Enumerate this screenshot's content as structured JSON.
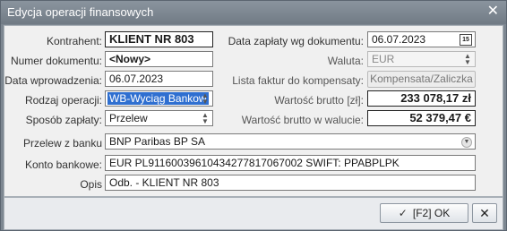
{
  "window": {
    "title": "Edycja operacji finansowych",
    "close_label": "✕"
  },
  "left": {
    "kontrahent": {
      "label": "Kontrahent:",
      "value": "KLIENT NR 803"
    },
    "numer": {
      "label": "Numer dokumentu:",
      "value": "<Nowy>"
    },
    "data_wprowadzenia": {
      "label": "Data wprowadzenia:",
      "value": "06.07.2023"
    },
    "rodzaj": {
      "label": "Rodzaj operacji:",
      "value": "WB-Wyciąg Bankow"
    },
    "sposob": {
      "label": "Sposób zapłaty:",
      "value": "Przelew"
    }
  },
  "right": {
    "data_zaplaty": {
      "label": "Data zapłaty wg dokumentu:",
      "value": "06.07.2023",
      "calendar_label": "15"
    },
    "waluta": {
      "label": "Waluta:",
      "value": "EUR"
    },
    "lista": {
      "label": "Lista faktur do kompensaty:",
      "button": "Kompensata/Zaliczka"
    },
    "wartosc_brutto": {
      "label": "Wartość brutto [zł]:",
      "value": "233 078,17 zł"
    },
    "wartosc_waluta": {
      "label": "Wartość brutto w walucie:",
      "value": "52 379,47 €"
    }
  },
  "bottom": {
    "przelew": {
      "label": "Przelew z banku",
      "value": "BNP Paribas BP SA"
    },
    "konto": {
      "label": "Konto bankowe:",
      "value": "EUR PL91160039610434277817067002 SWIFT: PPABPLPK"
    },
    "opis": {
      "label": "Opis",
      "value": "Odb. - KLIENT NR 803"
    }
  },
  "footer": {
    "ok_label": "[F2] OK",
    "ok_icon": "✓",
    "cancel_icon": "✕"
  }
}
